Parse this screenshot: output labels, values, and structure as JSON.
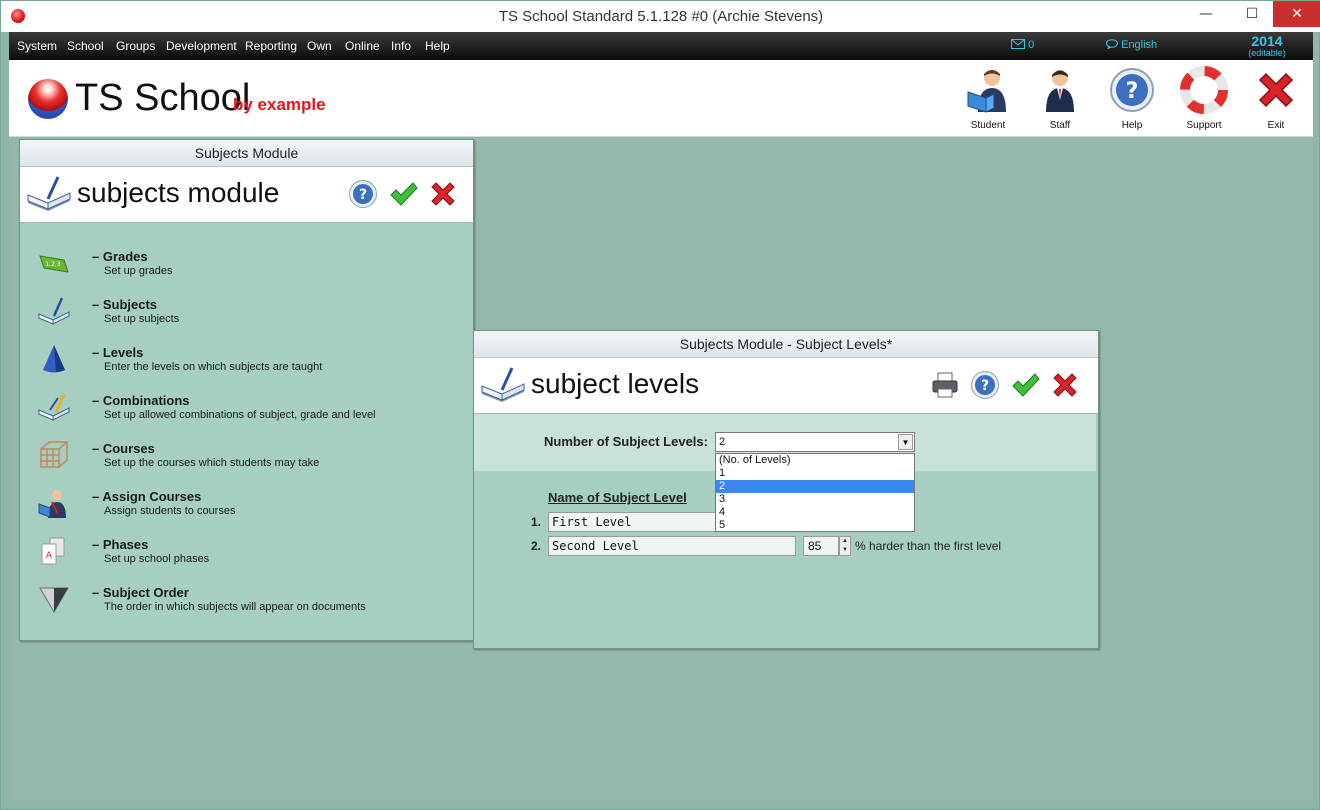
{
  "window": {
    "title": "TS School Standard 5.1.128 #0 (Archie Stevens)",
    "min_glyph": "—",
    "max_glyph": "☐",
    "close_glyph": "✕"
  },
  "menu": {
    "items": [
      "System",
      "School",
      "Groups",
      "Development",
      "Reporting",
      "Own",
      "Online",
      "Info",
      "Help"
    ],
    "mail_count": "0",
    "language": "English",
    "year": "2014",
    "year_note": "(editable)"
  },
  "header": {
    "logo_text": "TS School",
    "logo_sub": "by example",
    "tools": [
      {
        "label": "Student",
        "icon": "student-icon"
      },
      {
        "label": "Staff",
        "icon": "staff-icon"
      },
      {
        "label": "Help",
        "icon": "help-icon"
      },
      {
        "label": "Support",
        "icon": "lifebuoy-icon"
      },
      {
        "label": "Exit",
        "icon": "exit-icon"
      }
    ]
  },
  "subjects_panel": {
    "title": "Subjects Module",
    "heading": "subjects module",
    "items": [
      {
        "title": "– Grades",
        "desc": "Set up grades",
        "icon": "grades-icon"
      },
      {
        "title": "– Subjects",
        "desc": "Set up subjects",
        "icon": "book-icon"
      },
      {
        "title": "– Levels",
        "desc": "Enter the levels on which subjects are taught",
        "icon": "cone-icon"
      },
      {
        "title": "– Combinations",
        "desc": "Set up allowed combinations of subject, grade and level",
        "icon": "combination-icon"
      },
      {
        "title": "– Courses",
        "desc": "Set up the courses which students may take",
        "icon": "grid-cube-icon"
      },
      {
        "title": "– Assign Courses",
        "desc": "Assign students to courses",
        "icon": "assign-icon"
      },
      {
        "title": "– Phases",
        "desc": "Set up school phases",
        "icon": "phases-icon"
      },
      {
        "title": "– Subject Order",
        "desc": "The order in which subjects will appear on documents",
        "icon": "funnel-icon"
      }
    ]
  },
  "levels_dialog": {
    "title": "Subjects Module - Subject Levels*",
    "heading": "subject levels",
    "num_label": "Number of Subject Levels:",
    "selected": "2",
    "options": [
      "(No. of Levels)",
      "1",
      "2",
      "3",
      "4",
      "5"
    ],
    "selected_index": 2,
    "col_header": "Name of Subject Level",
    "rows": [
      {
        "num": "1.",
        "name": "First Level"
      },
      {
        "num": "2.",
        "name": "Second Level"
      }
    ],
    "harder_value": "85",
    "harder_text": "% harder than the first level"
  },
  "colors": {
    "accent": "#e3161b",
    "desktop": "#94b9aa",
    "panel": "#a6cfc2",
    "menu_accent": "#35c3e6",
    "selection": "#3d86ef"
  }
}
